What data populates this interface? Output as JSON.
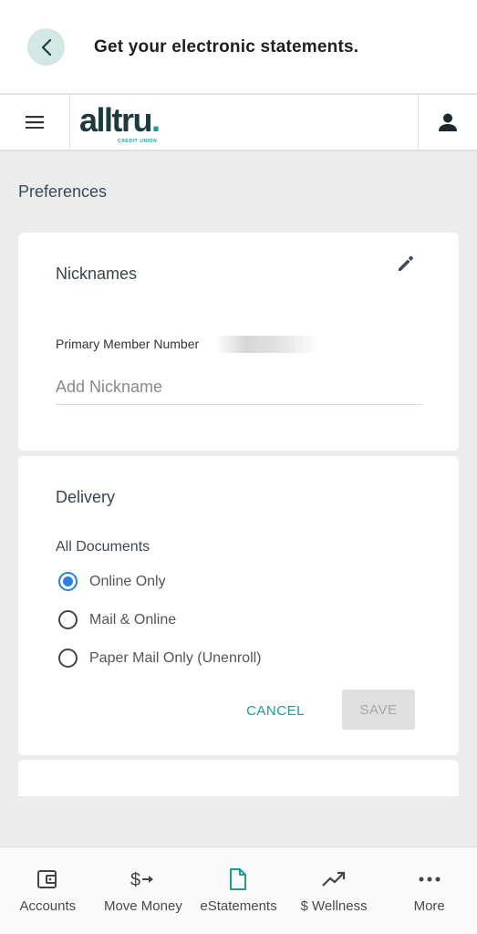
{
  "topbar": {
    "title": "Get your electronic statements."
  },
  "header": {
    "logo_text": "alltru",
    "logo_dot": ".",
    "logo_subtext": "CREDIT UNION"
  },
  "page": {
    "section_title": "Preferences"
  },
  "nicknames": {
    "title": "Nicknames",
    "field_label": "Primary Member Number",
    "input_value": "",
    "input_placeholder": "Add Nickname"
  },
  "delivery": {
    "title": "Delivery",
    "group_label": "All Documents",
    "options": [
      {
        "label": "Online Only",
        "checked": true
      },
      {
        "label": "Mail & Online",
        "checked": false
      },
      {
        "label": "Paper Mail Only (Unenroll)",
        "checked": false
      }
    ],
    "cancel_label": "CANCEL",
    "save_label": "SAVE"
  },
  "bottom_nav": [
    {
      "label": "Accounts",
      "icon": "wallet-icon"
    },
    {
      "label": "Move Money",
      "icon": "transfer-icon"
    },
    {
      "label": "eStatements",
      "icon": "document-icon",
      "active": true
    },
    {
      "label": "$ Wellness",
      "icon": "trending-icon"
    },
    {
      "label": "More",
      "icon": "more-icon"
    }
  ],
  "colors": {
    "accent": "#1a9e92",
    "radio_selected": "#2f7ee0",
    "back_button_bg": "#d3e8e4",
    "logo_dark": "#1d3a3e"
  }
}
